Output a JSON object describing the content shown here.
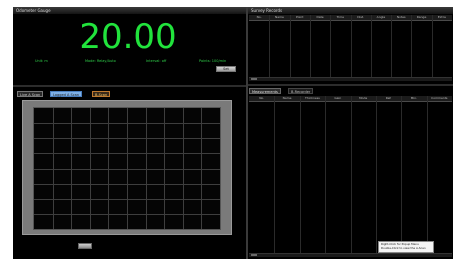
{
  "gauge": {
    "title": "Odometer Gauge",
    "value": "20.00",
    "meta": [
      "Unit: m",
      "Mode: Relay/Auto",
      "Interval: off",
      "Points: 100/min"
    ],
    "button_label": "Set"
  },
  "survey": {
    "title": "Survey Records",
    "columns": [
      "No.",
      "Name",
      "Point",
      "Date",
      "Time",
      "Dist.",
      "Angle",
      "Notes",
      "Range",
      "Extra"
    ]
  },
  "chart_tabs": [
    {
      "label": "Live A Scan",
      "fg": "#cfcfcf",
      "bg": "#2a2a2a",
      "border": "#777"
    },
    {
      "label": "Logged A Scan",
      "fg": "#1a1a1a",
      "bg": "#7fb0e6",
      "border": "#4a7fc0"
    },
    {
      "label": "B-Scan",
      "fg": "#ffcc66",
      "bg": "#3a2a1a",
      "border": "#c07a30"
    }
  ],
  "measurements": {
    "tabs": [
      "Measurements",
      "B-Recorder"
    ],
    "columns": [
      "No.",
      "Name",
      "Thickness",
      "Gain",
      "Mode",
      "Ref.",
      "Min.",
      "Comments"
    ]
  },
  "tooltip": {
    "lines": [
      "Right-Click for Popup Menu",
      "Double-Click to view the A-Scan"
    ]
  },
  "colors": {
    "accent_green": "#21e33c",
    "background": "#000000"
  }
}
